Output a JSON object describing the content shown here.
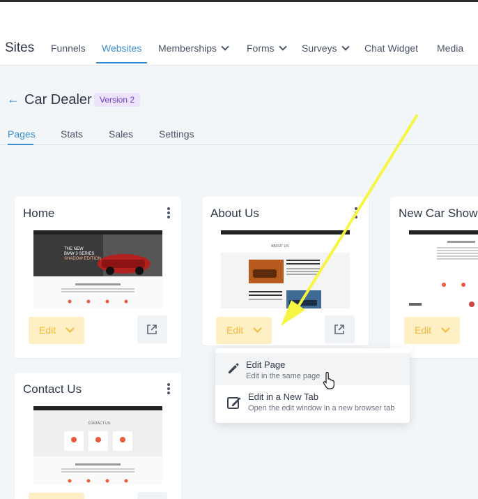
{
  "nav": {
    "title": "Sites",
    "items": [
      {
        "label": "Funnels"
      },
      {
        "label": "Websites"
      },
      {
        "label": "Memberships"
      },
      {
        "label": "Forms"
      },
      {
        "label": "Surveys"
      },
      {
        "label": "Chat Widget"
      },
      {
        "label": "Media"
      }
    ],
    "active_item": "Websites"
  },
  "header": {
    "back_icon": "arrow-left-icon",
    "title": "Car Dealer",
    "version_badge": "Version 2"
  },
  "tabs": [
    {
      "label": "Pages"
    },
    {
      "label": "Stats"
    },
    {
      "label": "Sales"
    },
    {
      "label": "Settings"
    }
  ],
  "active_tab": "Pages",
  "cards": [
    {
      "title": "Home",
      "edit_label": "Edit"
    },
    {
      "title": "About Us",
      "edit_label": "Edit"
    },
    {
      "title": "New Car Show",
      "edit_label": "Edit"
    },
    {
      "title": "Contact Us",
      "edit_label": ""
    }
  ],
  "dropdown": {
    "items": [
      {
        "title": "Edit Page",
        "subtitle": "Edit in the same page",
        "icon": "pencil-icon"
      },
      {
        "title": "Edit in a New Tab",
        "subtitle": "Open the edit window in a new browser tab",
        "icon": "edit-external-icon"
      }
    ]
  },
  "thumbnails": {
    "home_hero_lines": [
      "THE NEW",
      "BMW 3 SERIES",
      "SHADOW EDITION"
    ],
    "about_section": "ABOUT US",
    "contact_section": "CONTACT US"
  },
  "colors": {
    "accent": "#3b8fd0",
    "edit_button_bg": "#ffefc4",
    "edit_button_text": "#f1b93a",
    "annotation_arrow": "#f5f542",
    "version_badge_bg": "#ede4fb",
    "version_badge_text": "#6b3fc2"
  }
}
